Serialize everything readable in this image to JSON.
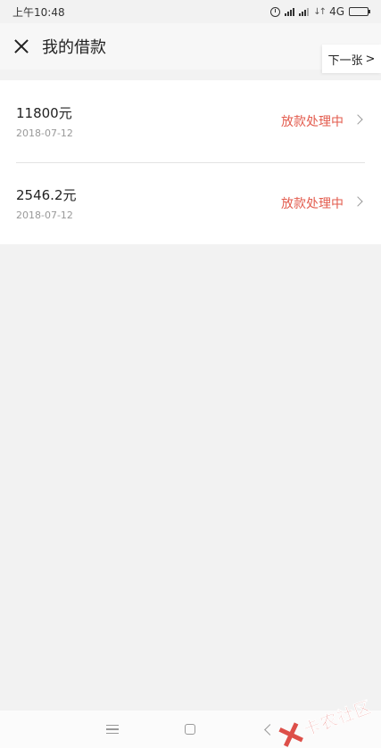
{
  "status_bar": {
    "time": "上午10:48",
    "network": "4G"
  },
  "header": {
    "title": "我的借款",
    "next_label": "下一张"
  },
  "loans": [
    {
      "amount": "11800元",
      "date": "2018-07-12",
      "status": "放款处理中"
    },
    {
      "amount": "2546.2元",
      "date": "2018-07-12",
      "status": "放款处理中"
    }
  ],
  "watermark": {
    "text": "卡农社区"
  },
  "colors": {
    "status_text": "#e35b4d",
    "background": "#f2f2f2",
    "card": "#ffffff"
  },
  "icons": {
    "close": "close-icon",
    "next": "chevron-right-icon",
    "row_arrow": "chevron-right-icon",
    "nav_menu": "menu-icon",
    "nav_home": "home-icon",
    "nav_back": "back-icon"
  }
}
